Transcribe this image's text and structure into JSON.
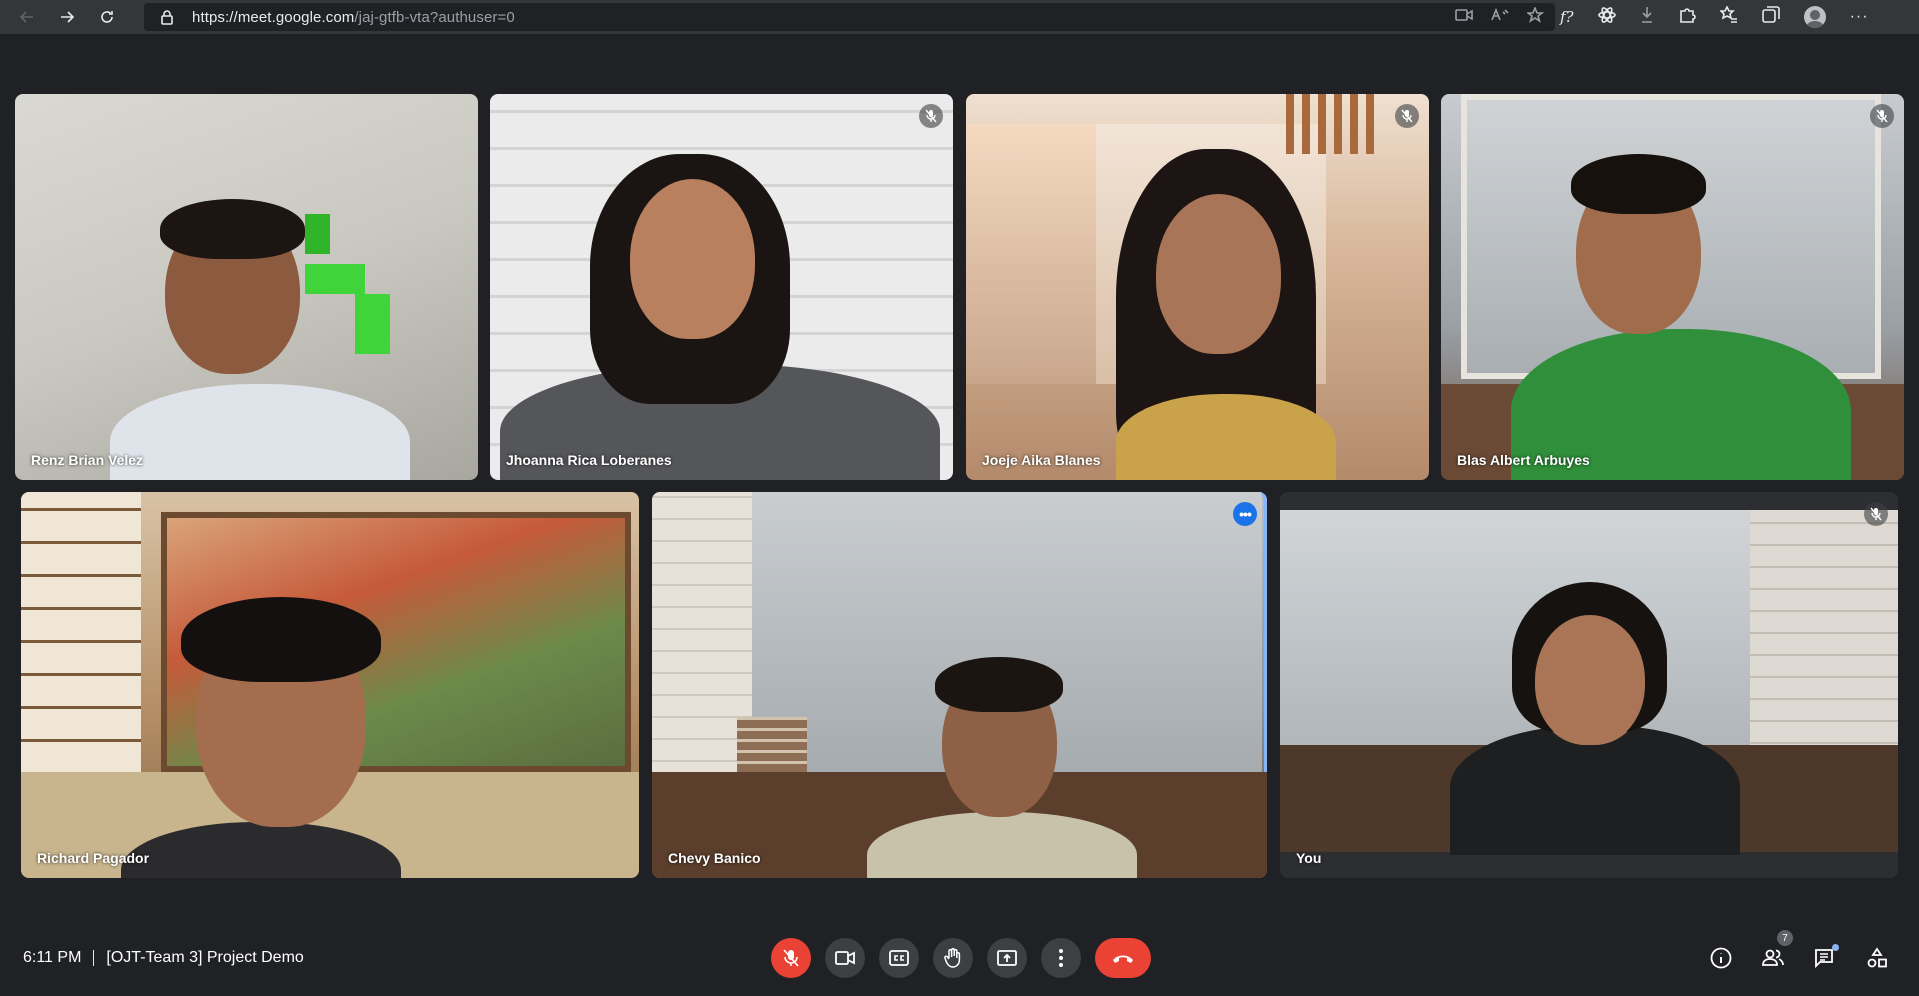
{
  "browser": {
    "url_domain": "https://meet.google.com",
    "url_path": "/jaj-gtfb-vta?authuser=0"
  },
  "participants": [
    {
      "name": "Renz Brian Velez",
      "muted": false
    },
    {
      "name": "Jhoanna Rica Loberanes",
      "muted": true
    },
    {
      "name": "Joeje Aika Blanes",
      "muted": true
    },
    {
      "name": "Blas Albert Arbuyes",
      "muted": true
    },
    {
      "name": "Richard Pagador",
      "muted": false
    },
    {
      "name": "Chevy Banico",
      "muted": false,
      "speaking": true
    },
    {
      "name": "You",
      "muted": true
    }
  ],
  "meeting": {
    "time": "6:11 PM",
    "title": "[OJT-Team 3] Project Demo",
    "participant_count": "7",
    "more_glyph": "•••"
  },
  "colors": {
    "accent": "#8ab4f8",
    "end_call": "#ea4335",
    "bar_bg": "#202124"
  }
}
